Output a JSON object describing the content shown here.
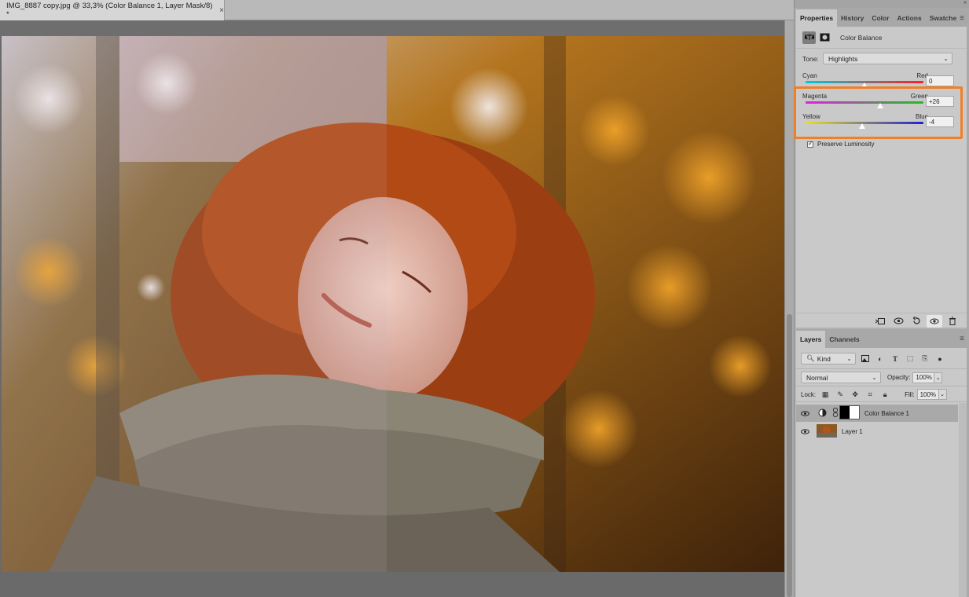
{
  "document_tab": {
    "title": "IMG_8887 copy.jpg @ 33,3% (Color Balance 1, Layer Mask/8) *",
    "close_glyph": "×"
  },
  "panels": {
    "top_tabs": [
      "Properties",
      "History",
      "Color",
      "Actions",
      "Swatche"
    ],
    "properties": {
      "adjustment_name": "Color Balance",
      "tone_label": "Tone:",
      "tone_value": "Highlights",
      "sliders": [
        {
          "left": "Cyan",
          "right": "Red",
          "value": "0",
          "level": 0
        },
        {
          "left": "Magenta",
          "right": "Green",
          "value": "+26",
          "level": 26
        },
        {
          "left": "Yellow",
          "right": "Blue",
          "value": "-4",
          "level": -4
        }
      ],
      "preserve_luminosity": "Preserve Luminosity",
      "preserve_checked": true
    },
    "layers_tabs": [
      "Layers",
      "Channels"
    ],
    "layers": {
      "filter_kind": "Kind",
      "blend_mode": "Normal",
      "opacity_label": "Opacity:",
      "opacity_value": "100%",
      "lock_label": "Lock:",
      "fill_label": "Fill:",
      "fill_value": "100%",
      "items": [
        {
          "name": "Color Balance 1",
          "selected": true
        },
        {
          "name": "Layer 1",
          "selected": false
        }
      ]
    }
  },
  "colors": {
    "highlight_box": "#f07f2a",
    "panel_bg": "#c9c9c9",
    "canvas_bg": "#6a6a6a"
  }
}
